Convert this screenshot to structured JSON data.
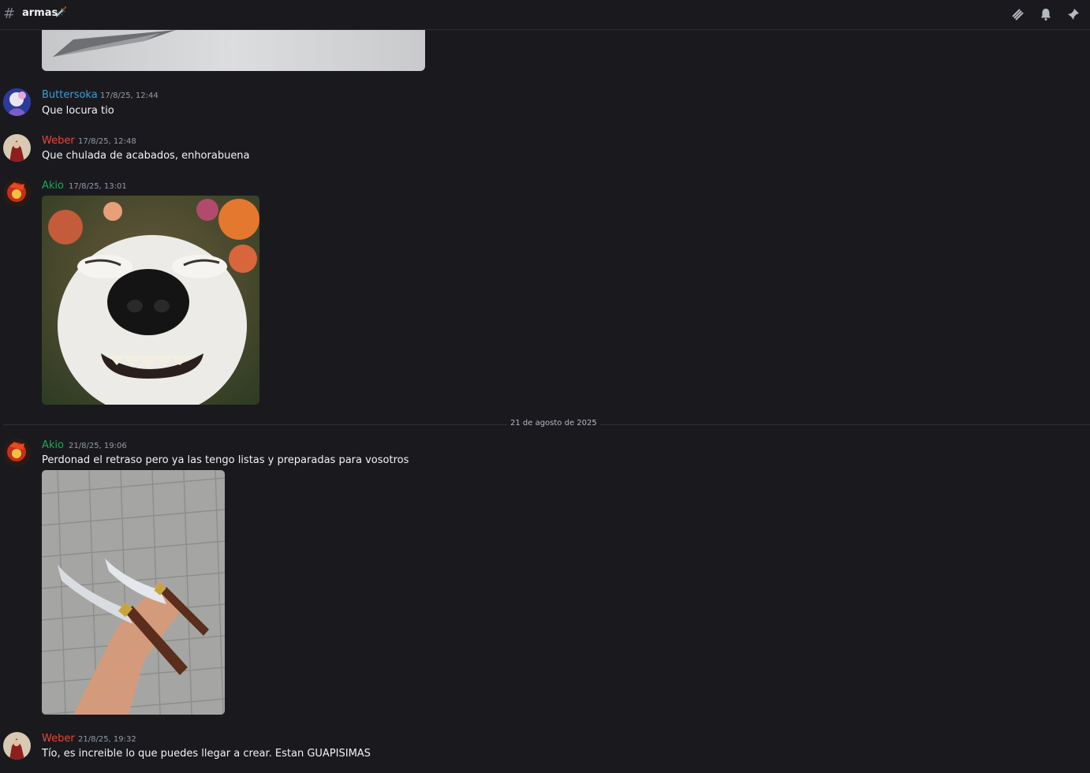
{
  "channel": {
    "name": "armas",
    "emoji": "🗡️"
  },
  "header_icons": [
    "threads-icon",
    "bell-icon",
    "pin-icon"
  ],
  "date_divider": "21 de agosto de 2025",
  "messages": [
    {
      "author": "Buttersoka",
      "timestamp": "17/8/25, 12:44",
      "text": "Que locura tio",
      "author_color": "#3a9fd8"
    },
    {
      "author": "Weber",
      "timestamp": "17/8/25, 12:48",
      "text": "Que chulada de acabados, enhorabuena",
      "author_color": "#e8473c"
    },
    {
      "author": "Akio",
      "timestamp": "17/8/25, 13:01",
      "text": "",
      "author_color": "#23a55a"
    },
    {
      "author": "Akio",
      "timestamp": "21/8/25, 19:06",
      "text": "Perdonad el retraso pero ya las tengo listas y preparadas para vosotros",
      "author_color": "#23a55a"
    },
    {
      "author": "Weber",
      "timestamp": "21/8/25, 19:32",
      "text": "Tío, es increible lo que puedes llegar a crear. Estan GUAPISIMAS",
      "author_color": "#e8473c"
    }
  ]
}
